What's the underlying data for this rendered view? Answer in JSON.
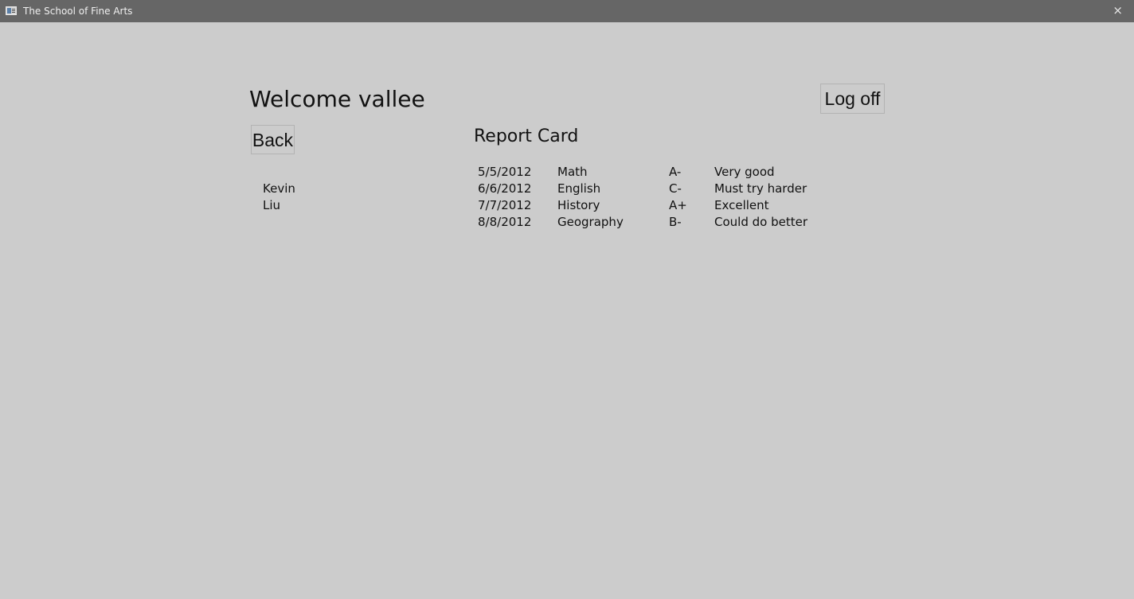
{
  "window": {
    "title": "The School of Fine Arts",
    "close_glyph": "×"
  },
  "header": {
    "welcome": "Welcome vallee",
    "logoff_label": "Log off"
  },
  "nav": {
    "back_label": "Back"
  },
  "students": [
    "Kevin",
    "Liu"
  ],
  "report_card": {
    "title": "Report Card",
    "rows": [
      {
        "date": "5/5/2012",
        "subject": "Math",
        "grade": "A-",
        "comment": "Very good"
      },
      {
        "date": "6/6/2012",
        "subject": "English",
        "grade": "C-",
        "comment": "Must try harder"
      },
      {
        "date": "7/7/2012",
        "subject": "History",
        "grade": "A+",
        "comment": "Excellent"
      },
      {
        "date": "8/8/2012",
        "subject": "Geography",
        "grade": "B-",
        "comment": "Could do better"
      }
    ]
  },
  "colors": {
    "background": "#cccccc",
    "titlebar": "#666666"
  }
}
